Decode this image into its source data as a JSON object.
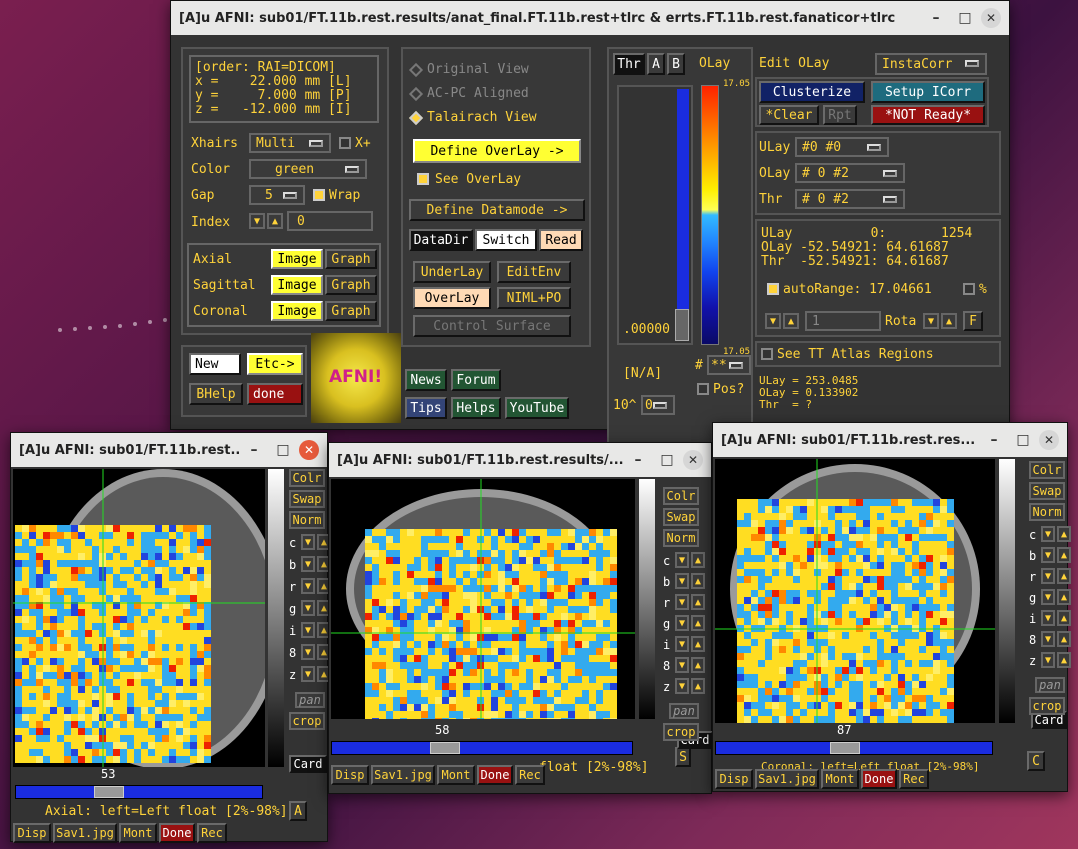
{
  "main_window": {
    "title": "[A]u AFNI: sub01/FT.11b.rest.results/anat_final.FT.11b.rest+tlrc & errts.FT.11b.rest.fanaticor+tlrc",
    "coords": {
      "order": "[order: RAI=DICOM]",
      "x": "x =    22.000 mm [L]",
      "y": "y =     7.000 mm [P]",
      "z": "z =   -12.000 mm [I]"
    },
    "xhairs_label": "Xhairs",
    "xhairs_value": "Multi",
    "xplus_label": "X+",
    "color_label": "Color",
    "color_value": "green",
    "gap_label": "Gap",
    "gap_value": "5",
    "wrap_label": "Wrap",
    "index_label": "Index",
    "index_value": "0",
    "views": [
      {
        "name": "Axial",
        "image": "Image",
        "graph": "Graph"
      },
      {
        "name": "Sagittal",
        "image": "Image",
        "graph": "Graph"
      },
      {
        "name": "Coronal",
        "image": "Image",
        "graph": "Graph"
      }
    ],
    "new_label": "New",
    "etc_label": "Etc->",
    "bhelp_label": "BHelp",
    "done_label": "done",
    "logo_text": "AFNI!",
    "news_label": "News",
    "forum_label": "Forum",
    "tips_label": "Tips",
    "helps_label": "Helps",
    "youtube_label": "YouTube",
    "view_options": [
      "Original View",
      "AC-PC Aligned",
      "Talairach View"
    ],
    "define_overlay": "Define OverLay ->",
    "see_overlay": "See OverLay",
    "define_datamode": "Define Datamode ->",
    "datadir": "DataDir",
    "switch": "Switch",
    "read": "Read",
    "underlay": "UnderLay",
    "editenv": "EditEnv",
    "overlay": "OverLay",
    "nimlpo": "NIML+PO",
    "control_surface": "Control Surface",
    "thr_label": "Thr",
    "a_label": "A",
    "b_label": "B",
    "olay_label": "OLay",
    "cbar_top": "17.05",
    "cbar_bottom": "17.05",
    "thr_value": ".00000",
    "na_label": "[N/A]",
    "pow_label": "10^",
    "pow_value": "0",
    "hash_value": "**",
    "pos_label": "Pos?",
    "edit_olay": "Edit OLay",
    "instacorr": "InstaCorr",
    "clusterize": "Clusterize",
    "setup_icorr": "Setup ICorr",
    "clear": "*Clear",
    "rpt": "Rpt",
    "not_ready": "*NOT Ready*",
    "ulay_row": {
      "label": "ULay",
      "value": "#0 #0"
    },
    "olay_row": {
      "label": "OLay",
      "value": "#  0 #2"
    },
    "thr_row": {
      "label": "Thr",
      "value": "#  0 #2"
    },
    "info_lines": [
      "ULay          0:       1254",
      "OLay -52.54921: 64.61687",
      "Thr  -52.54921: 64.61687"
    ],
    "autorange": "autoRange: 17.04661",
    "pct": "%",
    "rota_value": "1",
    "rota_label": "Rota",
    "f_label": "F",
    "see_tt": "See TT Atlas Regions",
    "readout": [
      "ULay = 253.0485",
      "OLay = 0.133902",
      "Thr  = ?"
    ]
  },
  "axial_window": {
    "title": "[A]u AFNI: sub01/FT.11b.rest...",
    "slice_number": "53",
    "caption": "Axial: left=Left float [2%-98%]",
    "a_btn": "A",
    "card": "Card"
  },
  "sagittal_window": {
    "title": "[A]u AFNI: sub01/FT.11b.rest.results/...",
    "slice_number": "58",
    "caption": "float [2%-98%]",
    "s_btn": "S",
    "card": "Card"
  },
  "coronal_window": {
    "title": "[A]u AFNI: sub01/FT.11b.rest.res...",
    "slice_number": "87",
    "caption": "Coronal: left=Left float [2%-98%]",
    "c_btn": "C",
    "card": "Card"
  },
  "image_side_buttons": [
    "Colr",
    "Swap",
    "Norm"
  ],
  "image_side_rows": [
    "c",
    "b",
    "r",
    "g",
    "i",
    "8",
    "z"
  ],
  "pan_label": "pan",
  "crop_label": "crop",
  "bottom_buttons": [
    "Disp",
    "Sav1.jpg",
    "Mont",
    "Done",
    "Rec"
  ],
  "colors": {
    "afni_yellow": "#ffd33a",
    "panel_bg": "#333333",
    "overlay_yellow": "#ffdd22",
    "overlay_blue": "#2299dd"
  }
}
